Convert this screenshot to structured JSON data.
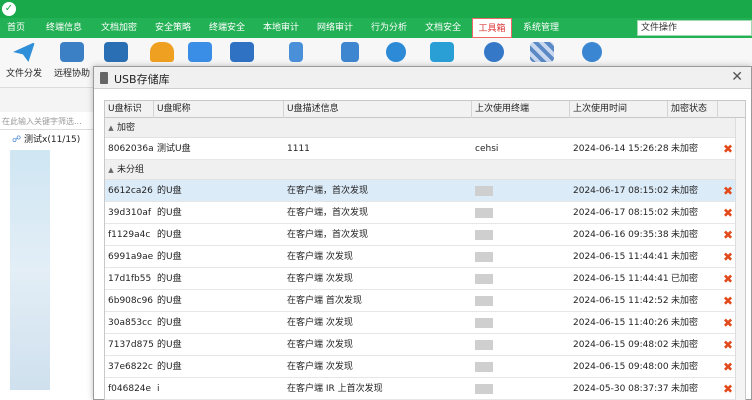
{
  "app": {
    "title": "",
    "menu_tabs": [
      "首页",
      "终端信息",
      "文档加密",
      "安全策略",
      "终端安全",
      "本地审计",
      "网络审计",
      "行为分析",
      "文档安全",
      "工具箱",
      "系统管理"
    ],
    "active_tab": "工具箱",
    "search_value": "文件操作"
  },
  "toolbar": {
    "items": [
      {
        "label": "文件分发",
        "icon": "send-icon",
        "color": "#2f8fd8"
      },
      {
        "label": "远程协助",
        "icon": "remote-screen-icon",
        "color": "#3b7fc4"
      },
      {
        "label": "",
        "icon": "monitor-icon",
        "color": "#2a6fb3"
      },
      {
        "label": "",
        "icon": "bell-icon",
        "color": "#f0a020"
      },
      {
        "label": "",
        "icon": "chat-icon",
        "color": "#3a8ee6"
      },
      {
        "label": "",
        "icon": "video-icon",
        "color": "#2f72c4"
      },
      {
        "label": "",
        "icon": "usb-icon",
        "color": "#4a90d9"
      },
      {
        "label": "",
        "icon": "tools-icon",
        "color": "#3e86cf"
      },
      {
        "label": "",
        "icon": "globe-icon",
        "color": "#2c8ad6"
      },
      {
        "label": "",
        "icon": "exchange-icon",
        "color": "#2a9fd6"
      },
      {
        "label": "",
        "icon": "gear-icon",
        "color": "#3578c8"
      },
      {
        "label": "",
        "icon": "checker-icon",
        "color": "#5b89c6"
      },
      {
        "label": "",
        "icon": "clock-gear-icon",
        "color": "#3a86d2"
      }
    ]
  },
  "left_panel": {
    "filter_placeholder": "在此输入关键字筛选...",
    "tree_root": "测试x(11/15)"
  },
  "dialog": {
    "title": "USB存储库",
    "columns": [
      "U盘标识",
      "U盘昵称",
      "U盘描述信息",
      "上次使用终端",
      "上次使用时间",
      "加密状态"
    ],
    "groups": [
      {
        "name": "加密",
        "rows": [
          {
            "id": "8062036a",
            "nickname": "测试U盘",
            "desc": "1111",
            "terminal": "cehsi",
            "time": "2024-06-14 15:26:28",
            "status": "未加密"
          }
        ]
      },
      {
        "name": "未分组",
        "rows": [
          {
            "id": "6612ca26",
            "nickname": "的U盘",
            "desc": "在客户端，首次发现",
            "terminal": "",
            "time": "2024-06-17 08:15:02",
            "status": "未加密"
          },
          {
            "id": "39d310af",
            "nickname": "的U盘",
            "desc": "在客户端，首次发现",
            "terminal": "",
            "time": "2024-06-17 08:15:02",
            "status": "未加密"
          },
          {
            "id": "f1129a4c",
            "nickname": "的U盘",
            "desc": "在客户端，首次发现",
            "terminal": "",
            "time": "2024-06-16 09:35:38",
            "status": "未加密"
          },
          {
            "id": "6991a9ae",
            "nickname": "的U盘",
            "desc": "在客户端 次发现",
            "terminal": "",
            "time": "2024-06-15 11:44:41",
            "status": "未加密"
          },
          {
            "id": "17d1fb55",
            "nickname": "的U盘",
            "desc": "在客户端 次发现",
            "terminal": "",
            "time": "2024-06-15 11:44:41",
            "status": "已加密"
          },
          {
            "id": "6b908c96",
            "nickname": "的U盘",
            "desc": "在客户端 首次发现",
            "terminal": "",
            "time": "2024-06-15 11:42:52",
            "status": "未加密"
          },
          {
            "id": "30a853cc",
            "nickname": "的U盘",
            "desc": "在客户端 次发现",
            "terminal": "",
            "time": "2024-06-15 11:40:26",
            "status": "未加密"
          },
          {
            "id": "7137d875",
            "nickname": "的U盘",
            "desc": "在客户端 次发现",
            "terminal": "",
            "time": "2024-06-15 09:48:02",
            "status": "未加密"
          },
          {
            "id": "37e6822c",
            "nickname": "的U盘",
            "desc": "在客户端 次发现",
            "terminal": "",
            "time": "2024-06-15 09:48:00",
            "status": "未加密"
          },
          {
            "id": "f046824e",
            "nickname": "i",
            "desc": "在客户端 IR 上首次发现",
            "terminal": "",
            "time": "2024-05-30 08:37:37",
            "status": "未加密"
          }
        ]
      }
    ]
  }
}
